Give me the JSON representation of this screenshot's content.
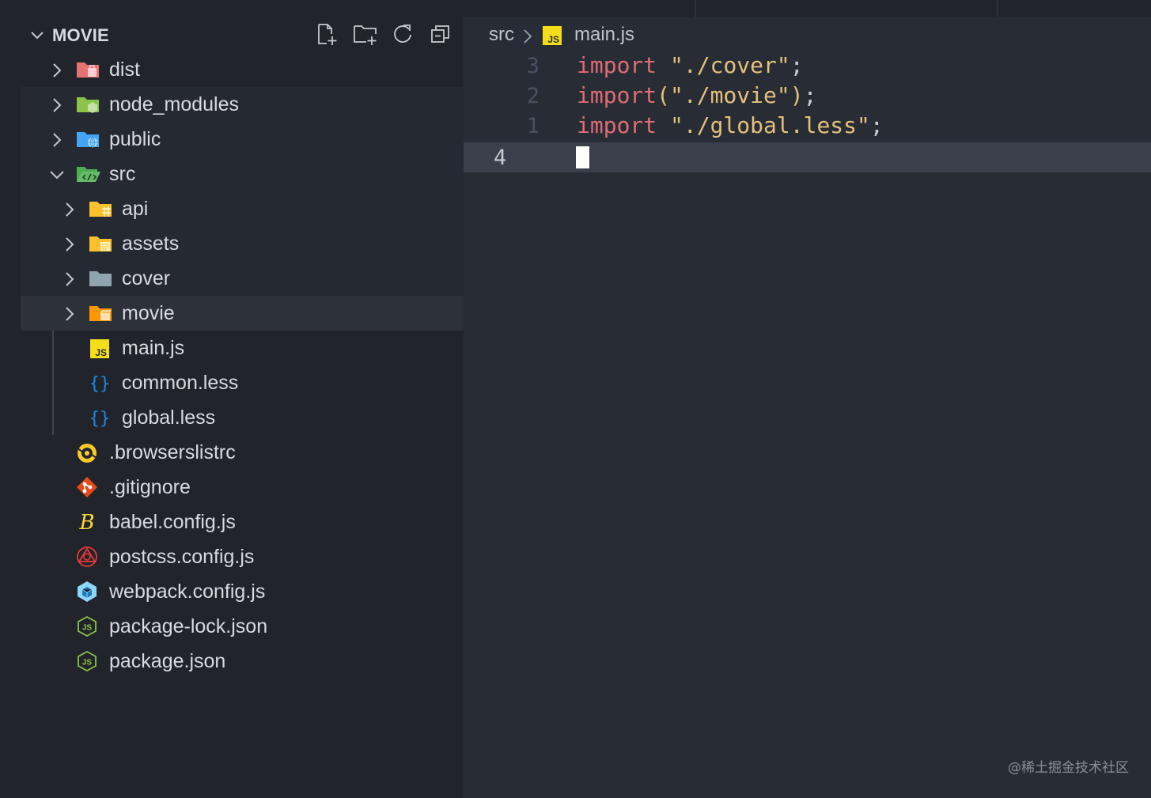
{
  "explorer": {
    "title": "MOVIE",
    "actions": [
      {
        "name": "new-file-icon"
      },
      {
        "name": "new-folder-icon"
      },
      {
        "name": "refresh-icon"
      },
      {
        "name": "collapse-all-icon"
      }
    ],
    "items": [
      {
        "label": "dist",
        "icon": "folder-dist-icon"
      },
      {
        "label": "node_modules",
        "icon": "folder-node-icon"
      },
      {
        "label": "public",
        "icon": "folder-public-icon"
      },
      {
        "label": "src",
        "icon": "folder-src-open-icon"
      },
      {
        "label": "api",
        "icon": "folder-api-icon"
      },
      {
        "label": "assets",
        "icon": "folder-assets-icon"
      },
      {
        "label": "cover",
        "icon": "folder-icon"
      },
      {
        "label": "movie",
        "icon": "folder-movie-icon"
      },
      {
        "label": "main.js",
        "icon": "javascript-file-icon"
      },
      {
        "label": "common.less",
        "icon": "less-file-icon"
      },
      {
        "label": "global.less",
        "icon": "less-file-icon"
      },
      {
        "label": ".browserslistrc",
        "icon": "browserslist-icon"
      },
      {
        "label": ".gitignore",
        "icon": "git-icon"
      },
      {
        "label": "babel.config.js",
        "icon": "babel-icon"
      },
      {
        "label": "postcss.config.js",
        "icon": "postcss-icon"
      },
      {
        "label": "webpack.config.js",
        "icon": "webpack-icon"
      },
      {
        "label": "package-lock.json",
        "icon": "nodejs-icon"
      },
      {
        "label": "package.json",
        "icon": "nodejs-icon"
      }
    ]
  },
  "breadcrumb": {
    "folder": "src",
    "file": "main.js",
    "file_badge": "JS"
  },
  "editor": {
    "lines": [
      {
        "number": "3",
        "keyword": "import",
        "open": " ",
        "string": "\"./cover\"",
        "close": "",
        "end": ";"
      },
      {
        "number": "2",
        "keyword": "import",
        "open": "(",
        "string": "\"./movie\"",
        "close": ")",
        "end": ";"
      },
      {
        "number": "1",
        "keyword": "import",
        "open": " ",
        "string": "\"./global.less\"",
        "close": "",
        "end": ";"
      },
      {
        "number": "4",
        "keyword": "",
        "open": "",
        "string": "",
        "close": "",
        "end": ""
      }
    ],
    "current_line": 4
  },
  "watermark": "@稀土掘金技术社区",
  "colors": {
    "keyword": "#e06c75",
    "string": "#e5c07b",
    "sidebar_bg": "#21252b",
    "editor_bg": "#282c34"
  }
}
